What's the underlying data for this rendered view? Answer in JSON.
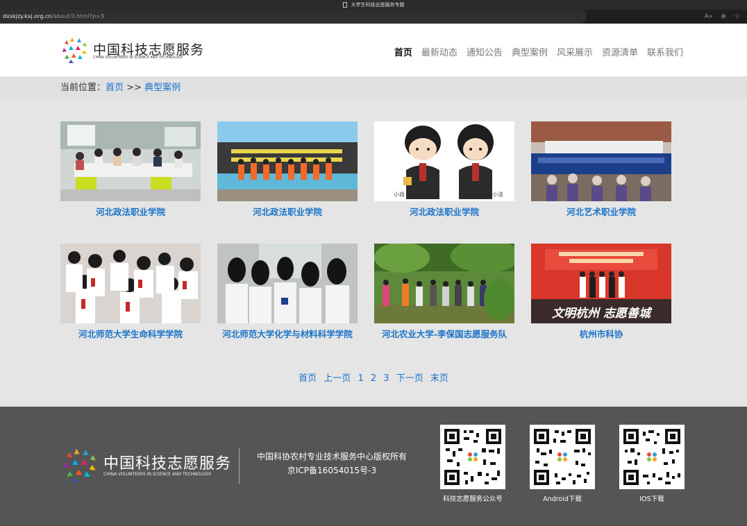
{
  "browser": {
    "tab_title": "大学生科技志愿服务专题",
    "url_host": "dxskjzy.kxj.org.cn",
    "url_path": "/about/3.html?p=3"
  },
  "header": {
    "logo_title": "中国科技志愿服务",
    "logo_subtitle": "CHINA VOLUNTEERS IN SCIENCE AND TECHNOLOGY",
    "nav": [
      "首页",
      "最新动态",
      "通知公告",
      "典型案例",
      "风采展示",
      "资源清单",
      "联系我们"
    ],
    "active_nav": "首页"
  },
  "breadcrumb": {
    "prefix": "当前位置：",
    "home": "首页",
    "sep": " >> ",
    "current": "典型案例"
  },
  "cases": [
    {
      "caption": "河北政法职业学院",
      "image": "meeting-room-photo"
    },
    {
      "caption": "河北政法职业学院",
      "image": "volunteers-in-orange-photo"
    },
    {
      "caption": "河北政法职业学院",
      "image": "cartoon-judges-illustration"
    },
    {
      "caption": "河北艺术职业学院",
      "image": "village-stage-photo"
    },
    {
      "caption": "河北师范大学生命科学学院",
      "image": "students-crowd-photo"
    },
    {
      "caption": "河北师范大学化学与材料科学学院",
      "image": "students-lab-photo"
    },
    {
      "caption": "河北农业大学-李保国志愿服务队",
      "image": "orchard-group-photo"
    },
    {
      "caption": "杭州市科协",
      "image": "award-ceremony-photo"
    }
  ],
  "illustration_labels": {
    "left": "小尚",
    "right": "小法"
  },
  "award_banner": "文明杭州  志愿善城",
  "pagination": [
    "首页",
    "上一页",
    "1",
    "2",
    "3",
    "下一页",
    "末页"
  ],
  "footer": {
    "logo_title": "中国科技志愿服务",
    "logo_subtitle": "CHINA VOLUNTEERS IN SCIENCE AND TECHNOLOGY",
    "copyright": "中国科协农村专业技术服务中心版权所有",
    "icp": "京ICP备16054015号-3",
    "qrcodes": [
      {
        "label": "科技志愿服务公众号"
      },
      {
        "label": "Android下载"
      },
      {
        "label": "IOS下载"
      }
    ]
  },
  "colors": {
    "link": "#1a73c8",
    "footer_bg": "#555555",
    "header_bg": "#ffffff",
    "page_bg": "#e5e5e5"
  }
}
